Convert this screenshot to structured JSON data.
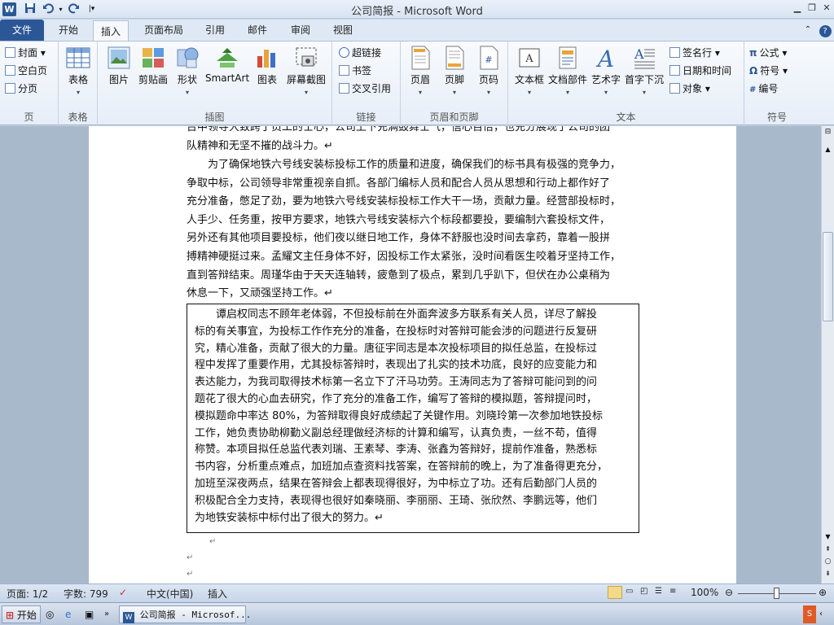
{
  "window": {
    "title": "公司简报 - Microsoft Word"
  },
  "quick_access": [
    "save-icon",
    "undo-icon",
    "redo-icon",
    "customize-icon"
  ],
  "tabs": [
    {
      "label": "文件"
    },
    {
      "label": "开始"
    },
    {
      "label": "插入"
    },
    {
      "label": "页面布局"
    },
    {
      "label": "引用"
    },
    {
      "label": "邮件"
    },
    {
      "label": "审阅"
    },
    {
      "label": "视图"
    }
  ],
  "active_tab": "插入",
  "ribbon": {
    "pages": {
      "label": "页",
      "cover": "封面",
      "blank": "空白页",
      "break": "分页"
    },
    "tables": {
      "label": "表格",
      "table": "表格"
    },
    "illustrations": {
      "label": "插图",
      "picture": "图片",
      "clipart": "剪贴画",
      "shapes": "形状",
      "smartart": "SmartArt",
      "chart": "图表",
      "screenshot": "屏幕截图"
    },
    "links": {
      "label": "链接",
      "hyperlink": "超链接",
      "bookmark": "书签",
      "crossref": "交叉引用"
    },
    "headerfooter": {
      "label": "页眉和页脚",
      "header": "页眉",
      "footer": "页脚",
      "pagenum": "页码"
    },
    "text": {
      "label": "文本",
      "textbox": "文本框",
      "quickparts": "文档部件",
      "wordart": "艺术字",
      "dropcap": "首字下沉",
      "signature": "签名行",
      "datetime": "日期和时间",
      "object": "对象"
    },
    "symbols": {
      "label": "符号",
      "equation": "公式",
      "symbol": "符号",
      "number": "编号"
    }
  },
  "document": {
    "top_lines": [
      "台中领导大致跨了员工的士心，公司上下充满鼓舞士气，信心百倍，也充分展现了公司的团",
      "队精神和无坚不摧的战斗力。↵"
    ],
    "para2_lines": [
      "为了确保地铁六号线安装标投标工作的质量和进度，确保我们的标书具有极强的竞争力，",
      "争取中标，公司领导非常重视亲自抓。各部门编标人员和配合人员从思想和行动上都作好了",
      "充分准备，憋足了劲，要为地铁六号线安装标投标工作大干一场，贡献力量。经营部投标时，",
      "人手少、任务重，按甲方要求，地铁六号线安装标六个标段都要投，要编制六套投标文件，",
      "另外还有其他项目要投标，他们夜以继日地工作，身体不舒服也没时间去拿药，靠着一股拼",
      "搏精神硬挺过来。孟耀文主任身体不好，因投标工作太紧张，没时间看医生咬着牙坚持工作，",
      "直到答辩结束。周瑾华由于天天连轴转，疲惫到了极点，累到几乎趴下，但伏在办公桌稍为",
      "休息一下，又顽强坚持工作。↵"
    ],
    "box_lines": [
      "谭启权同志不顾年老体弱，不但投标前在外面奔波多方联系有关人员，详尽了解投",
      "标的有关事宜，为投标工作作充分的准备，在投标时对答辩可能会涉的问题进行反复研",
      "究，精心准备，贡献了很大的力量。唐征宇同志是本次投标项目的拟任总监，在投标过",
      "程中发挥了重要作用，尤其投标答辩时，表现出了扎实的技术功底，良好的应变能力和",
      "表达能力，为我司取得技术标第一名立下了汗马功劳。王涛同志为了答辩可能问到的问",
      "题花了很大的心血去研究，作了充分的准备工作，编写了答辩的模拟题，答辩提问时，",
      "模拟题命中率达 80%，为答辩取得良好成绩起了关键作用。刘晓玲第一次参加地铁投标",
      "工作，她负责协助柳勤义副总经理做经济标的计算和编写，认真负责，一丝不苟，值得",
      "称赞。本项目拟任总监代表刘瑞、王素琴、李涛、张鑫为答辩好，提前作准备，熟悉标",
      "书内容，分析重点难点，加班加点查资料找答案，在答辩前的晚上，为了准备得更充分，",
      "加班至深夜两点，结果在答辩会上都表现得很好，为中标立了功。还有后勤部门人员的",
      "积极配合全力支持，表现得也很好如秦晓丽、李丽丽、王琦、张欣然、李鹏远等，他们",
      "为地铁安装标中标付出了很大的努力。↵"
    ],
    "empty_marks": [
      "↵",
      "↵",
      "↵"
    ]
  },
  "status": {
    "page": "页面: 1/2",
    "words": "字数: 799",
    "language": "中文(中国)",
    "mode": "插入",
    "zoom": "100%"
  },
  "taskbar": {
    "start": "开始",
    "window_button": "公司简报 - Microsof..."
  },
  "colors": {
    "accent": "#2b5797",
    "ribbon_bg": "#e6eef8",
    "doc_bg": "#a9b9cc"
  }
}
